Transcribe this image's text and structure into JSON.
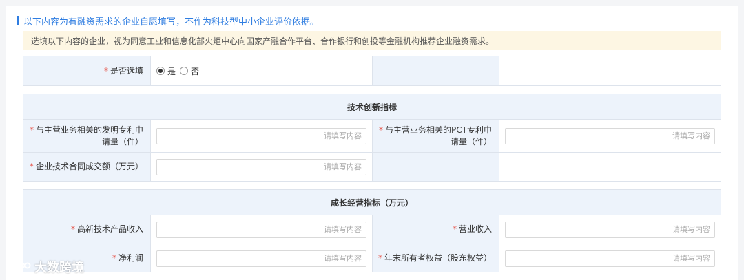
{
  "section_title": "以下内容为有融资需求的企业自愿填写，不作为科技型中小企业评价依据。",
  "notice": "选填以下内容的企业，视为同意工业和信息化部火炬中心向国家产融合作平台、合作银行和创投等金融机构推荐企业融资需求。",
  "optional_row": {
    "label": "是否选填",
    "required_mark": "*",
    "options": [
      "是",
      "否"
    ],
    "selected": "是"
  },
  "tech_group": {
    "title": "技术创新指标",
    "fields": [
      {
        "label_line1": "与主营业务相关的发明专利申",
        "label_line2": "请量（件）",
        "placeholder": "请填写内容",
        "value": ""
      },
      {
        "label_line1": "与主营业务相关的PCT专利申",
        "label_line2": "请量（件）",
        "placeholder": "请填写内容",
        "value": ""
      },
      {
        "label_line1": "企业技术合同成交额（万元）",
        "label_line2": "",
        "placeholder": "请填写内容",
        "value": ""
      }
    ]
  },
  "growth_group": {
    "title": "成长经营指标（万元）",
    "fields": [
      {
        "label": "高新技术产品收入",
        "placeholder": "请填写内容",
        "value": ""
      },
      {
        "label": "营业收入",
        "placeholder": "请填写内容",
        "value": ""
      },
      {
        "label": "净利润",
        "placeholder": "请填写内容",
        "value": ""
      },
      {
        "label": "年末所有者权益（股东权益）",
        "placeholder": "请填写内容",
        "value": ""
      }
    ]
  },
  "watermark": "大数跨境",
  "colors": {
    "accent": "#2f7de1",
    "required": "#e54d42",
    "notice_bg": "#fdf6e3",
    "label_bg": "#edf3fb"
  }
}
